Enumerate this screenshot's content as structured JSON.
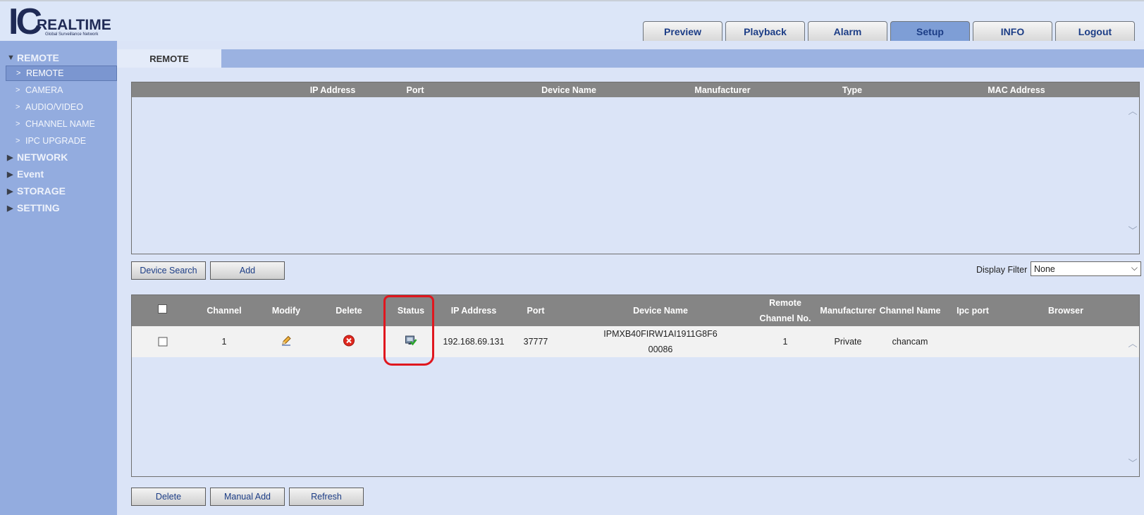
{
  "logo": {
    "mark": "IC",
    "name": "REALTIME",
    "tagline": "Global Surveillance Network"
  },
  "nav": [
    {
      "label": "Preview"
    },
    {
      "label": "Playback"
    },
    {
      "label": "Alarm"
    },
    {
      "label": "Setup",
      "active": true
    },
    {
      "label": "INFO"
    },
    {
      "label": "Logout"
    }
  ],
  "sidebar": {
    "groups": [
      {
        "label": "REMOTE",
        "expanded": true
      },
      {
        "label": "NETWORK"
      },
      {
        "label": "Event"
      },
      {
        "label": "STORAGE"
      },
      {
        "label": "SETTING"
      }
    ],
    "items": [
      {
        "label": "REMOTE",
        "active": true
      },
      {
        "label": "CAMERA"
      },
      {
        "label": "AUDIO/VIDEO"
      },
      {
        "label": "CHANNEL NAME"
      },
      {
        "label": "IPC UPGRADE"
      }
    ]
  },
  "page_tab": "REMOTE",
  "search_table": {
    "columns": [
      "IP Address",
      "Port",
      "Device Name",
      "Manufacturer",
      "Type",
      "MAC Address"
    ]
  },
  "buttons": {
    "device_search": "Device Search",
    "add": "Add",
    "delete": "Delete",
    "manual_add": "Manual Add",
    "refresh": "Refresh"
  },
  "display_filter": {
    "label": "Display Filter",
    "value": "None"
  },
  "device_table": {
    "columns": [
      "Channel",
      "Modify",
      "Delete",
      "Status",
      "IP Address",
      "Port",
      "Device Name",
      "Remote",
      "Channel No.",
      "Manufacturer",
      "Channel Name",
      "Ipc port",
      "Browser"
    ],
    "rows": [
      {
        "channel": "1",
        "status": "online",
        "ip": "192.168.69.131",
        "port": "37777",
        "device_name_1": "IPMXB40FIRW1AI1911G8F6",
        "device_name_2": "00086",
        "remote_channel": "1",
        "manufacturer": "Private",
        "channel_name": "chancam",
        "ipc_port": "",
        "browser": ""
      }
    ]
  },
  "colors": {
    "accent": "#93acdf",
    "header_gray": "#858585",
    "annotation": "#e0171f"
  }
}
